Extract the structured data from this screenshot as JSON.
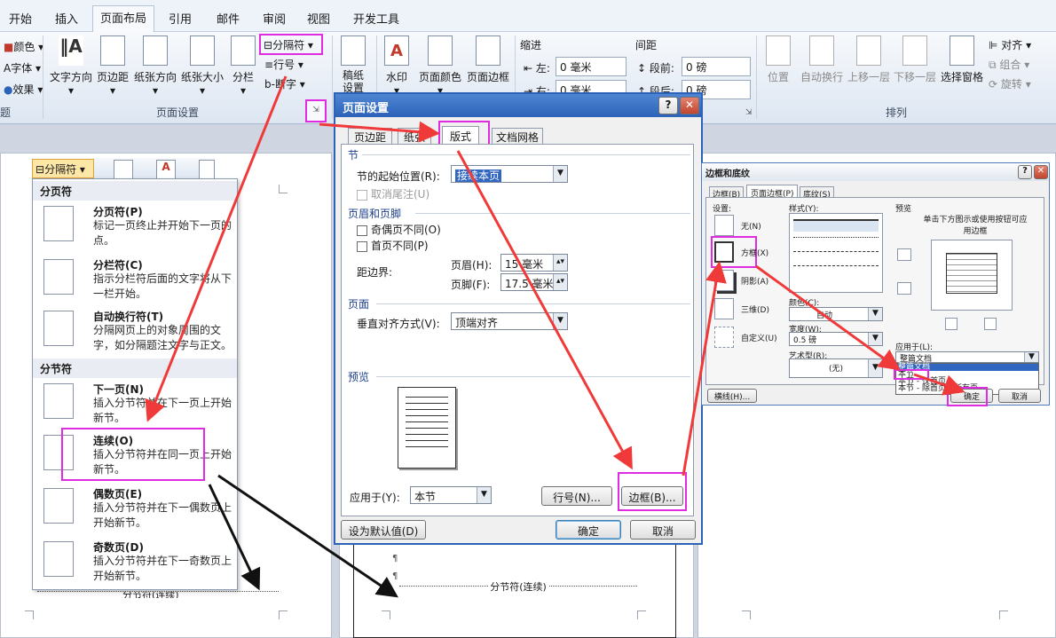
{
  "ribbon": {
    "tabs": [
      "开始",
      "插入",
      "页面布局",
      "引用",
      "邮件",
      "审阅",
      "视图",
      "开发工具"
    ],
    "theme_items": [
      "颜色",
      "字体",
      "效果"
    ],
    "page_setup_buttons": [
      "文字方向",
      "页边距",
      "纸张方向",
      "纸张大小",
      "分栏"
    ],
    "small_buttons": {
      "breaks": "分隔符",
      "line_numbers": "行号",
      "hyphenation": "断字"
    },
    "manuscript": "稿纸\n设置",
    "page_background_buttons": [
      "水印",
      "页面颜色",
      "页面边框"
    ],
    "indent": {
      "title": "缩进",
      "left_label": "左:",
      "left_value": "0 毫米",
      "right_label": "右:",
      "right_value": "0 毫米"
    },
    "spacing": {
      "title": "间距",
      "before_label": "段前:",
      "before_value": "0 磅",
      "after_label": "段后:",
      "after_value": "0 磅"
    },
    "arrange_buttons": [
      "位置",
      "自动换行",
      "上移一层",
      "下移一层",
      "选择窗格"
    ],
    "arrange_small": [
      "对齐",
      "组合",
      "旋转"
    ],
    "group_labels": {
      "theme": "题",
      "page_setup": "页面设置",
      "arrange": "排列"
    }
  },
  "breaks_menu": {
    "button": "分隔符",
    "page_breaks_title": "分页符",
    "section_breaks_title": "分节符",
    "items": [
      {
        "title": "分页符(P)",
        "desc": "标记一页终止并开始下一页的点。"
      },
      {
        "title": "分栏符(C)",
        "desc": "指示分栏符后面的文字将从下一栏开始。"
      },
      {
        "title": "自动换行符(T)",
        "desc": "分隔网页上的对象周围的文字，如分隔题注文字与正文。"
      },
      {
        "title": "下一页(N)",
        "desc": "插入分节符并在下一页上开始新节。"
      },
      {
        "title": "连续(O)",
        "desc": "插入分节符并在同一页上开始新节。"
      },
      {
        "title": "偶数页(E)",
        "desc": "插入分节符并在下一偶数页上开始新节。"
      },
      {
        "title": "奇数页(D)",
        "desc": "插入分节符并在下一奇数页上开始新节。"
      }
    ]
  },
  "doc": {
    "section_break_text": "分节符(连续)",
    "left_break_text": "分节符(连续)",
    "pilcrow": "¶"
  },
  "page_setup_dialog": {
    "title": "页面设置",
    "help": "?",
    "close": "✕",
    "tabs": [
      "页边距",
      "纸张",
      "版式",
      "文档网格"
    ],
    "section_title": "节",
    "section_start_label": "节的起始位置(R):",
    "section_start_value": "接续本页",
    "cancel_endnotes": "取消尾注(U)",
    "header_footer_title": "页眉和页脚",
    "odd_even": "奇偶页不同(O)",
    "first_page": "首页不同(P)",
    "distance_label": "距边界:",
    "header_label": "页眉(H):",
    "header_value": "15 毫米",
    "footer_label": "页脚(F):",
    "footer_value": "17.5 毫米",
    "page_title": "页面",
    "valign_label": "垂直对齐方式(V):",
    "valign_value": "顶端对齐",
    "preview_title": "预览",
    "apply_label": "应用于(Y):",
    "apply_value": "本节",
    "line_numbers_btn": "行号(N)...",
    "borders_btn": "边框(B)...",
    "default_btn": "设为默认值(D)",
    "ok": "确定",
    "cancel": "取消"
  },
  "borders_dialog": {
    "title": "边框和底纹",
    "help": "?",
    "close": "✕",
    "tabs": [
      "边框(B)",
      "页面边框(P)",
      "底纹(S)"
    ],
    "setting_label": "设置:",
    "settings": [
      "无(N)",
      "方框(X)",
      "阴影(A)",
      "三维(D)",
      "自定义(U)"
    ],
    "style_label": "样式(Y):",
    "color_label": "颜色(C):",
    "color_value": "自动",
    "width_label": "宽度(W):",
    "width_value": "0.5 磅",
    "art_label": "艺术型(R):",
    "art_value": "(无)",
    "preview_label": "预览",
    "preview_hint": "单击下方图示或使用按钮可应用边框",
    "apply_label": "应用于(L):",
    "apply_value": "整篇文档",
    "apply_options": [
      "整篇文档",
      "本节",
      "本节 - 仅首页",
      "本节 - 除首页外所有页"
    ],
    "hline_btn": "横线(H)...",
    "ok": "确定",
    "cancel": "取消"
  },
  "colors": {
    "highlight": "#e02ce0",
    "arrow_red": "#f03a3a",
    "arrow_black": "#111111",
    "title_blue": "#2c62b8"
  }
}
